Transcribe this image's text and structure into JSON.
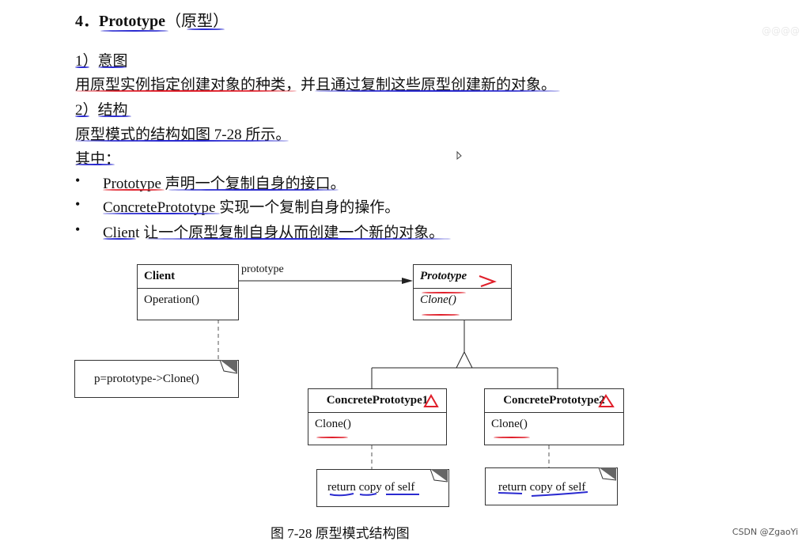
{
  "heading": {
    "number": "4．",
    "name": "Prototype",
    "zh": "（原型）"
  },
  "section1": {
    "label": "1）意图",
    "text": "用原型实例指定创建对象的种类，并且通过复制这些原型创建新的对象。"
  },
  "section2": {
    "label": "2）结构",
    "text": "原型模式的结构如图 7-28 所示。",
    "among": "其中："
  },
  "bullets": [
    {
      "symbol": "•",
      "term": "Prototype",
      "desc": " 声明一个复制自身的接口。"
    },
    {
      "symbol": "•",
      "term": "ConcretePrototype",
      "desc": " 实现一个复制自身的操作。"
    },
    {
      "symbol": "•",
      "term": "Client",
      "desc": " 让一个原型复制自身从而创建一个新的对象。"
    }
  ],
  "diagram": {
    "client": {
      "name": "Client",
      "op": "Operation()"
    },
    "association_label": "prototype",
    "client_note": "p=prototype->Clone()",
    "prototype": {
      "name": "Prototype",
      "op": "Clone()"
    },
    "concrete1": {
      "name": "ConcretePrototype1",
      "op": "Clone()",
      "note": "return copy of self"
    },
    "concrete2": {
      "name": "ConcretePrototype2",
      "op": "Clone()",
      "note": "return copy of self"
    }
  },
  "caption": "图 7-28    原型模式结构图",
  "watermark": "CSDN @ZgaoYi",
  "corner_mark": "@@@@"
}
